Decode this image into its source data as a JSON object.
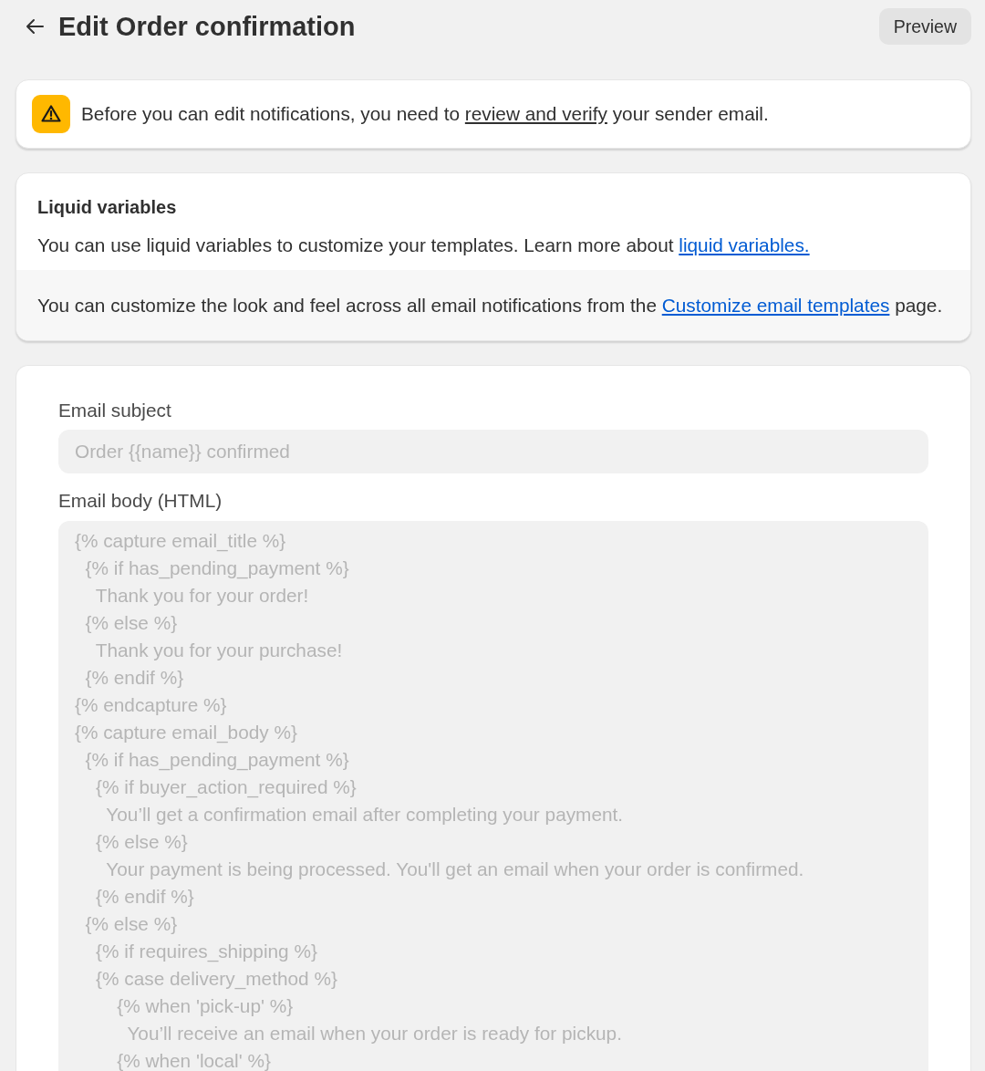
{
  "header": {
    "title": "Edit Order confirmation",
    "preview_button": "Preview"
  },
  "banner": {
    "kind": "warning",
    "text_before": "Before you can edit notifications, you need to",
    "link": "review and verify",
    "text_after": "your sender email."
  },
  "liquid_card": {
    "title": "Liquid variables",
    "text": "You can use liquid variables to customize your templates. Learn more about",
    "link": "liquid variables.",
    "footer": {
      "text_before": "You can customize the look and feel across all email notifications from the",
      "link": "Customize email templates",
      "text_after": "page."
    }
  },
  "form": {
    "fields": [
      {
        "kind": "input",
        "label": "Email subject",
        "value": "Order {{name}} confirmed",
        "disabled": true
      },
      {
        "kind": "textarea",
        "label": "Email body (HTML)",
        "value": "{% capture email_title %}\n  {% if has_pending_payment %}\n    Thank you for your order!\n  {% else %}\n    Thank you for your purchase!\n  {% endif %}\n{% endcapture %}\n{% capture email_body %}\n  {% if has_pending_payment %}\n    {% if buyer_action_required %}\n      You’ll get a confirmation email after completing your payment.\n    {% else %}\n      Your payment is being processed. You'll get an email when your order is confirmed.\n    {% endif %}\n  {% else %}\n    {% if requires_shipping %}\n    {% case delivery_method %}\n        {% when 'pick-up' %}\n          You’ll receive an email when your order is ready for pickup.\n        {% when 'local' %}",
        "disabled": true
      }
    ]
  }
}
